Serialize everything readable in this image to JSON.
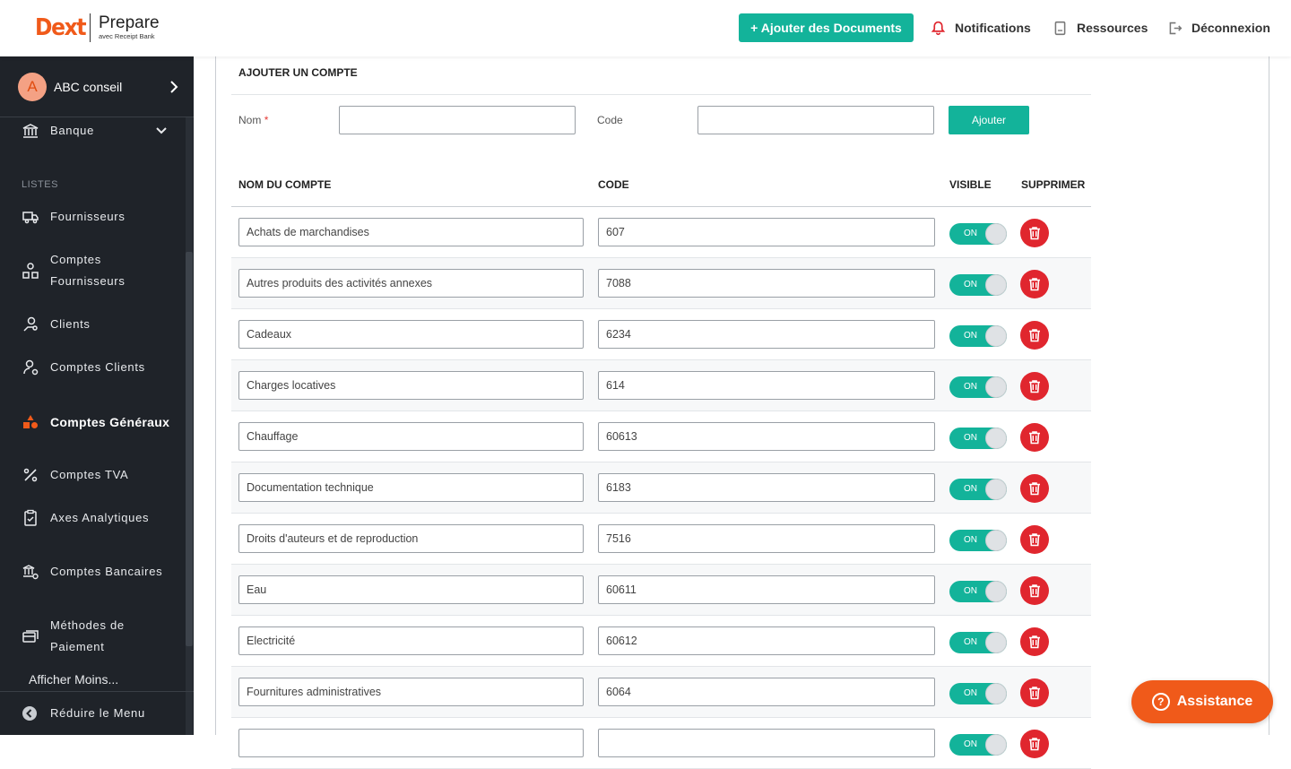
{
  "header": {
    "logo_main": "Dext",
    "logo_product": "Prepare",
    "logo_tagline": "avec Receipt Bank",
    "add_documents": "+ Ajouter des Documents",
    "notifications": "Notifications",
    "resources": "Ressources",
    "logout": "Déconnexion"
  },
  "sidebar": {
    "account": {
      "initial": "A",
      "name": "ABC conseil"
    },
    "bank": "Banque",
    "section_lists": "LISTES",
    "items": [
      {
        "label": "Fournisseurs",
        "icon": "truck-icon"
      },
      {
        "label": "Comptes Fournisseurs",
        "icon": "accounts-icon"
      },
      {
        "label": "Clients",
        "icon": "clients-icon"
      },
      {
        "label": "Comptes Clients",
        "icon": "client-accounts-icon"
      },
      {
        "label": "Comptes Généraux",
        "icon": "shapes-icon",
        "active": true
      },
      {
        "label": "Comptes TVA",
        "icon": "percent-icon"
      },
      {
        "label": "Axes Analytiques",
        "icon": "clipboard-icon"
      },
      {
        "label": "Comptes Bancaires",
        "icon": "bank-accounts-icon"
      },
      {
        "label": "Méthodes de Paiement",
        "icon": "payment-icon"
      }
    ],
    "show_less": "Afficher Moins...",
    "collapse": "Réduire le Menu"
  },
  "form": {
    "title": "AJOUTER UN COMPTE",
    "name_label": "Nom",
    "required_mark": "*",
    "code_label": "Code",
    "submit": "Ajouter"
  },
  "table": {
    "headers": {
      "name": "NOM DU COMPTE",
      "code": "CODE",
      "visible": "VISIBLE",
      "delete": "SUPPRIMER"
    },
    "rows": [
      {
        "name": "Achats de marchandises",
        "code": "607",
        "visible": "ON"
      },
      {
        "name": "Autres produits des activités annexes",
        "code": "7088",
        "visible": "ON"
      },
      {
        "name": "Cadeaux",
        "code": "6234",
        "visible": "ON"
      },
      {
        "name": "Charges locatives",
        "code": "614",
        "visible": "ON"
      },
      {
        "name": "Chauffage",
        "code": "60613",
        "visible": "ON"
      },
      {
        "name": "Documentation technique",
        "code": "6183",
        "visible": "ON"
      },
      {
        "name": "Droits d'auteurs et de reproduction",
        "code": "7516",
        "visible": "ON"
      },
      {
        "name": "Eau",
        "code": "60611",
        "visible": "ON"
      },
      {
        "name": "Electricité",
        "code": "60612",
        "visible": "ON"
      },
      {
        "name": "Fournitures administratives",
        "code": "6064",
        "visible": "ON"
      },
      {
        "name": "",
        "code": "",
        "visible": "ON"
      }
    ]
  },
  "assistance": "Assistance",
  "colors": {
    "brand": "#f05a1a",
    "accent": "#13b39a",
    "danger": "#e0262e",
    "sidebar": "#1f2329"
  }
}
